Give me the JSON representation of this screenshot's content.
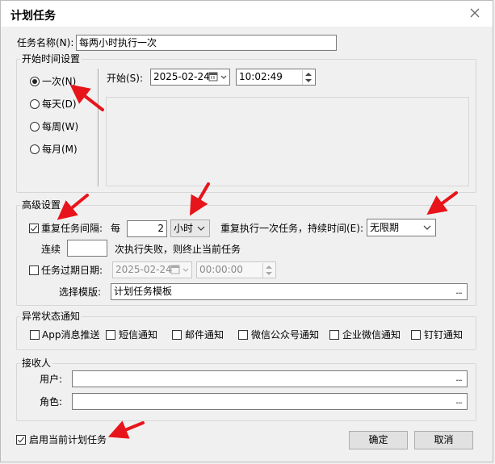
{
  "window": {
    "title": "计划任务"
  },
  "task_name": {
    "label": "任务名称(N):",
    "value": "每两小时执行一次"
  },
  "start_time": {
    "legend": "开始时间设置",
    "options": [
      {
        "label": "一次(N)",
        "selected": true
      },
      {
        "label": "每天(D)",
        "selected": false
      },
      {
        "label": "每周(W)",
        "selected": false
      },
      {
        "label": "每月(M)",
        "selected": false
      }
    ],
    "start_label": "开始(S):",
    "date": "2025-02-24",
    "time": "10:02:49"
  },
  "advanced": {
    "legend": "高级设置",
    "repeat": {
      "checked": true,
      "label": "重复任务间隔:",
      "every_label": "每",
      "every_value": "2",
      "unit": "小时",
      "duration_label": "重复执行一次任务，持续时间(E):",
      "duration": "无限期"
    },
    "consecutive": {
      "label": "连续",
      "value": "",
      "suffix": "次执行失败，则终止当前任务"
    },
    "expire": {
      "checked": false,
      "label": "任务过期日期:",
      "date": "2025-02-24",
      "time": "00:00:00"
    },
    "template": {
      "label": "选择模版:",
      "value": "计划任务模板",
      "btn": "..."
    }
  },
  "notify": {
    "legend": "异常状态通知",
    "options": [
      {
        "label": "App消息推送",
        "checked": false
      },
      {
        "label": "短信通知",
        "checked": false
      },
      {
        "label": "邮件通知",
        "checked": false
      },
      {
        "label": "微信公众号通知",
        "checked": false
      },
      {
        "label": "企业微信通知",
        "checked": false
      },
      {
        "label": "钉钉通知",
        "checked": false
      }
    ]
  },
  "receivers": {
    "legend": "接收人",
    "user_label": "用户:",
    "user_value": "",
    "role_label": "角色:",
    "role_value": "",
    "btn": "..."
  },
  "footer": {
    "enable": {
      "checked": true,
      "label": "启用当前计划任务"
    },
    "ok": "确定",
    "cancel": "取消"
  },
  "colors": {
    "annotation_arrow": "#e8141b",
    "window_bg": "#f0f0f0"
  },
  "icons": {
    "close": "close-icon",
    "calendar": "calendar-icon",
    "dropdown": "chevron-down-icon"
  }
}
